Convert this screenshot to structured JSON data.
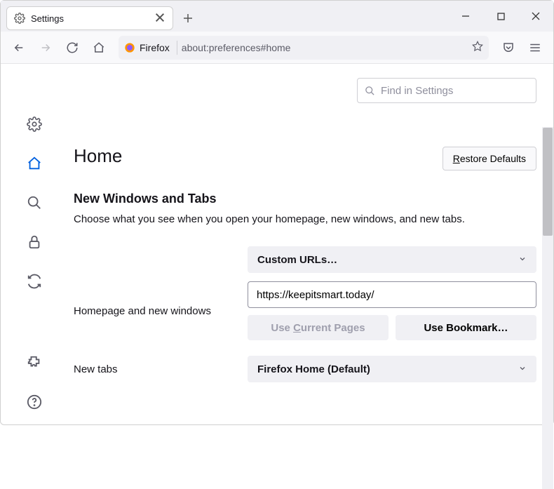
{
  "tab": {
    "title": "Settings"
  },
  "urlbar": {
    "label": "Firefox",
    "url": "about:preferences#home"
  },
  "search": {
    "placeholder": "Find in Settings"
  },
  "page": {
    "heading": "Home",
    "restore_label": "Restore Defaults",
    "section_heading": "New Windows and Tabs",
    "section_desc": "Choose what you see when you open your homepage, new windows, and new tabs."
  },
  "homepage": {
    "label": "Homepage and new windows",
    "dropdown_value": "Custom URLs…",
    "url_value": "https://keepitsmart.today/",
    "use_current": "Use Current Pages",
    "use_bookmark": "Use Bookmark…"
  },
  "newtabs": {
    "label": "New tabs",
    "dropdown_value": "Firefox Home (Default)"
  }
}
